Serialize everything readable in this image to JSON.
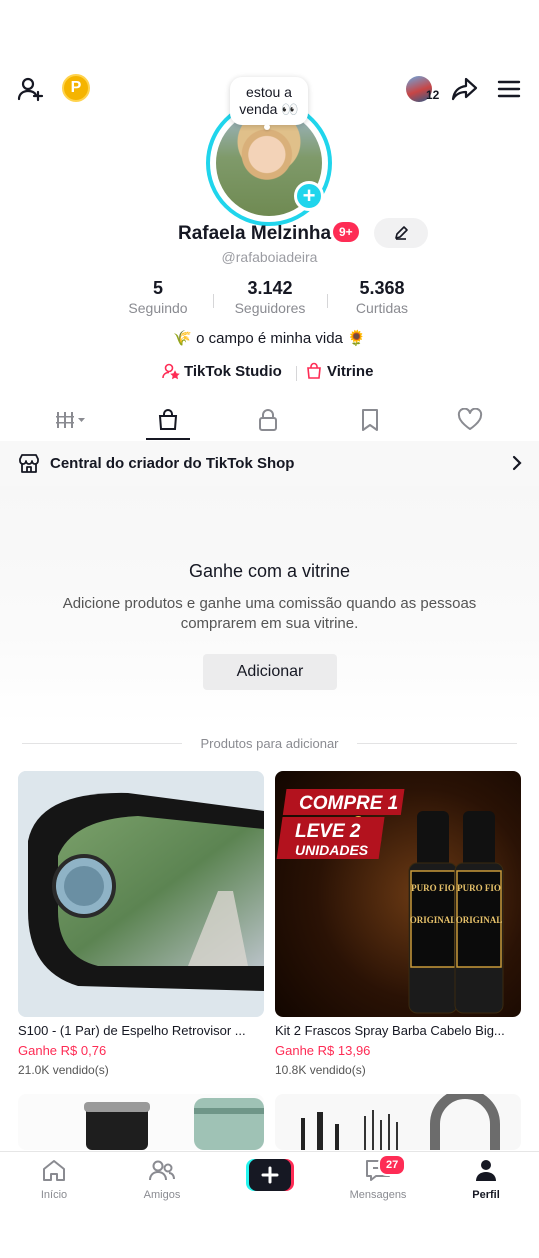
{
  "header": {
    "coin_label": "P",
    "avatar_count": "12"
  },
  "profile": {
    "bubble_text": "estou a venda 👀",
    "name": "Rafaela Melzinha",
    "badge": "9+",
    "username": "@rafaboiadeira",
    "stats": [
      {
        "value": "5",
        "label": "Seguindo"
      },
      {
        "value": "3.142",
        "label": "Seguidores"
      },
      {
        "value": "5.368",
        "label": "Curtidas"
      }
    ],
    "bio": "🌾 o campo é minha vida 🌻",
    "links": {
      "studio": "TikTok Studio",
      "vitrine": "Vitrine"
    }
  },
  "shop_bar": {
    "label": "Central do criador do TikTok Shop"
  },
  "promo": {
    "title": "Ganhe com a vitrine",
    "description": "Adicione produtos e ganhe uma comissão quando as pessoas comprarem em sua vitrine.",
    "button": "Adicionar"
  },
  "products_section": {
    "label": "Produtos para adicionar",
    "items": [
      {
        "title": "S100 - (1 Par) de Espelho Retrovisor ...",
        "earn": "Ganhe R$ 0,76",
        "sold": "21.0K vendido(s)"
      },
      {
        "title": "Kit 2 Frascos Spray Barba Cabelo Big...",
        "earn": "Ganhe R$ 13,96",
        "sold": "10.8K vendido(s)",
        "banner_line1": "COMPRE 1",
        "banner_amp": "&",
        "banner_line2": "LEVE 2",
        "banner_line3": "UNIDADES",
        "bottle_brand": "PURO FIO",
        "bottle_label": "ORIGINAL"
      }
    ]
  },
  "bottom_nav": {
    "items": [
      {
        "label": "Início"
      },
      {
        "label": "Amigos"
      },
      {
        "label": "Mensagens",
        "badge": "27"
      },
      {
        "label": "Perfil"
      }
    ]
  },
  "colors": {
    "accent": "#fe2c55",
    "cyan": "#20d5ec",
    "text": "#161823"
  }
}
